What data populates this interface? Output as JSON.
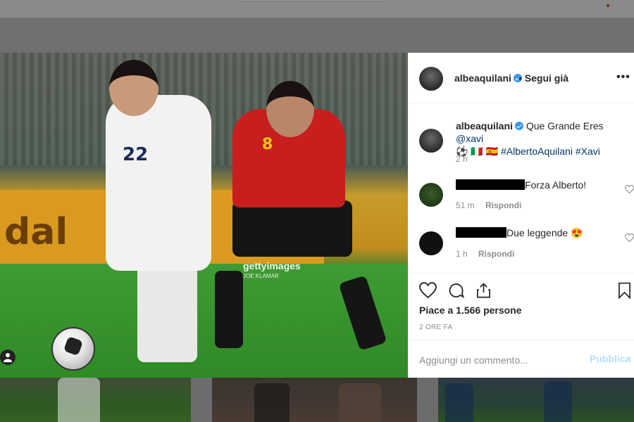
{
  "post": {
    "username": "albeaquilani",
    "follow_status": "• Segui già",
    "more": "•••",
    "caption_text": "Que Grande Eres",
    "caption_mention": "@xavi",
    "caption_flags": "⚽ 🇮🇹 🇪🇸",
    "caption_hashtags": "#AlbertoAquilani #Xavi",
    "caption_time": "2 h"
  },
  "photo": {
    "watermark_brand": "gettyimages",
    "watermark_credit": "JOE KLAMAR",
    "jersey_italy": "22",
    "jersey_spain": "8"
  },
  "comments": [
    {
      "text": "Forza Alberto!",
      "time": "51 m",
      "reply": "Rispondi"
    },
    {
      "text": "Due leggende 😍",
      "time": "1 h",
      "reply": "Rispondi"
    }
  ],
  "likes": "Piace a 1.566 persone",
  "date": "2 ORE FA",
  "add_comment": {
    "placeholder": "Aggiungi un commento...",
    "publish": "Pubblica"
  },
  "icons": [
    "heart-icon",
    "comment-icon",
    "share-icon",
    "bookmark-icon",
    "verified-icon",
    "user-tag-icon"
  ],
  "colors": {
    "link": "#003569",
    "verified": "#3897f0",
    "publish": "#b2dffc",
    "muted": "#8e8e8e"
  }
}
